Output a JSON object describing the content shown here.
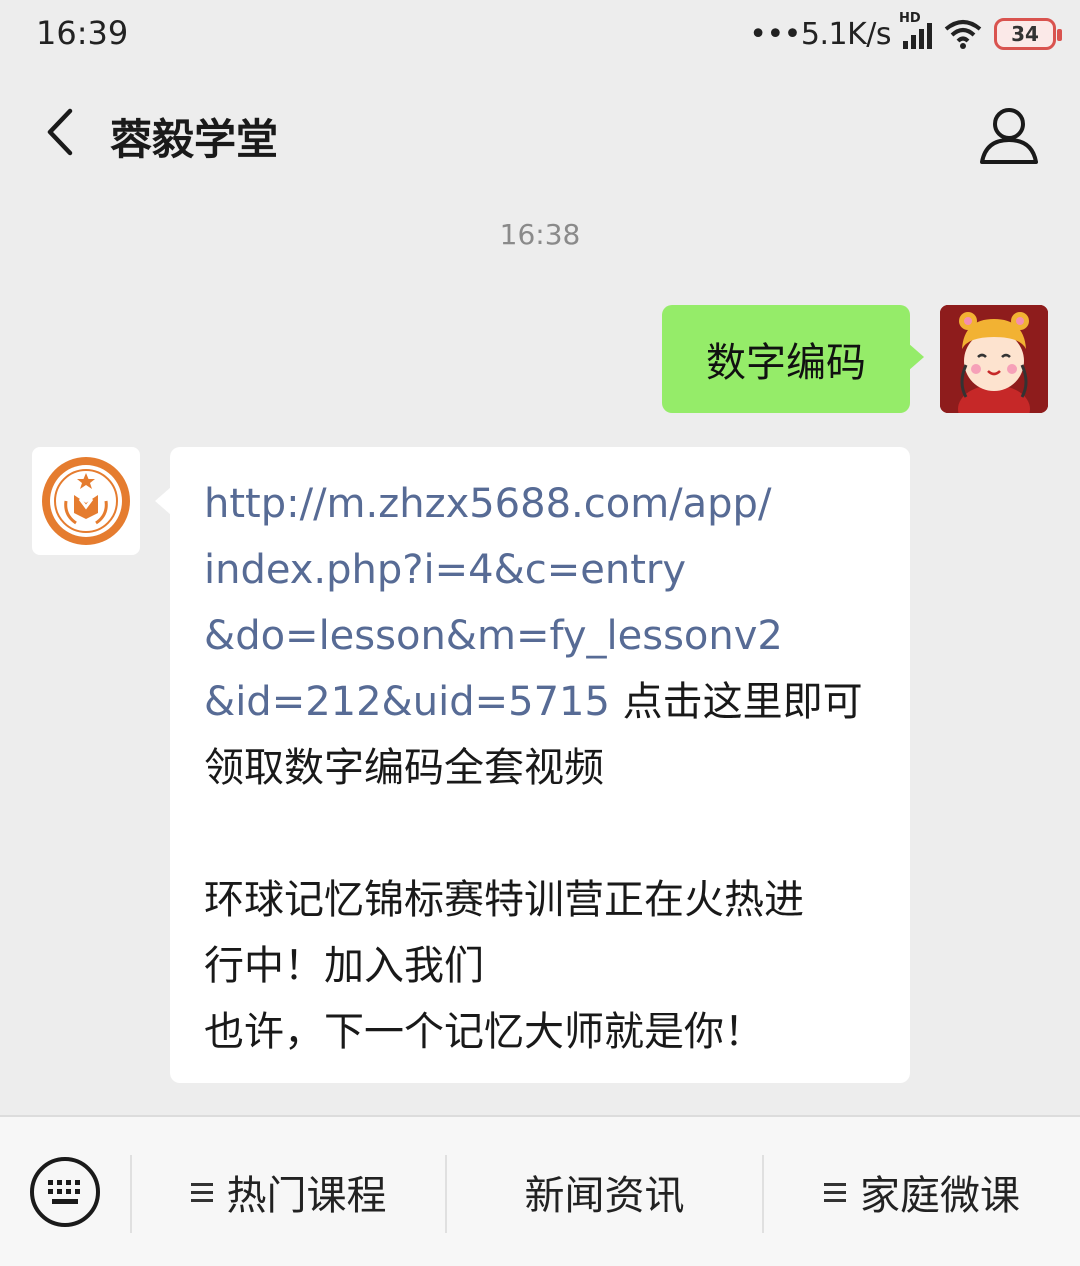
{
  "status_bar": {
    "time": "16:39",
    "network_speed": "5.1K/s",
    "hd_label": "HD",
    "battery_level": "34",
    "battery_color": "#d9534f"
  },
  "nav": {
    "title": "蓉毅学堂",
    "back_icon": "chevron-left-icon",
    "profile_icon": "person-icon"
  },
  "chat": {
    "timestamp": "16:38",
    "outgoing": {
      "text": "数字编码",
      "bubble_color": "#95ec69"
    },
    "incoming": {
      "link_lines": [
        "http://m.zhzx5688.com/app/",
        "index.php?i=4&c=entry",
        "&do=lesson&m=fy_lessonv2",
        "&id=212&uid=5715"
      ],
      "after_link": " 点击这里即可",
      "line5": "领取数字编码全套视频",
      "line6": "环球记忆锦标赛特训营正在火热进",
      "line7": "行中！加入我们",
      "line8": "也许，下一个记忆大师就是你！",
      "link_color": "#576b95"
    }
  },
  "bottom_menu": {
    "keyboard_icon": "keyboard-icon",
    "items": [
      {
        "label": "热门课程",
        "has_menu_icon": true
      },
      {
        "label": "新闻资讯",
        "has_menu_icon": false
      },
      {
        "label": "家庭微课",
        "has_menu_icon": true
      }
    ]
  }
}
